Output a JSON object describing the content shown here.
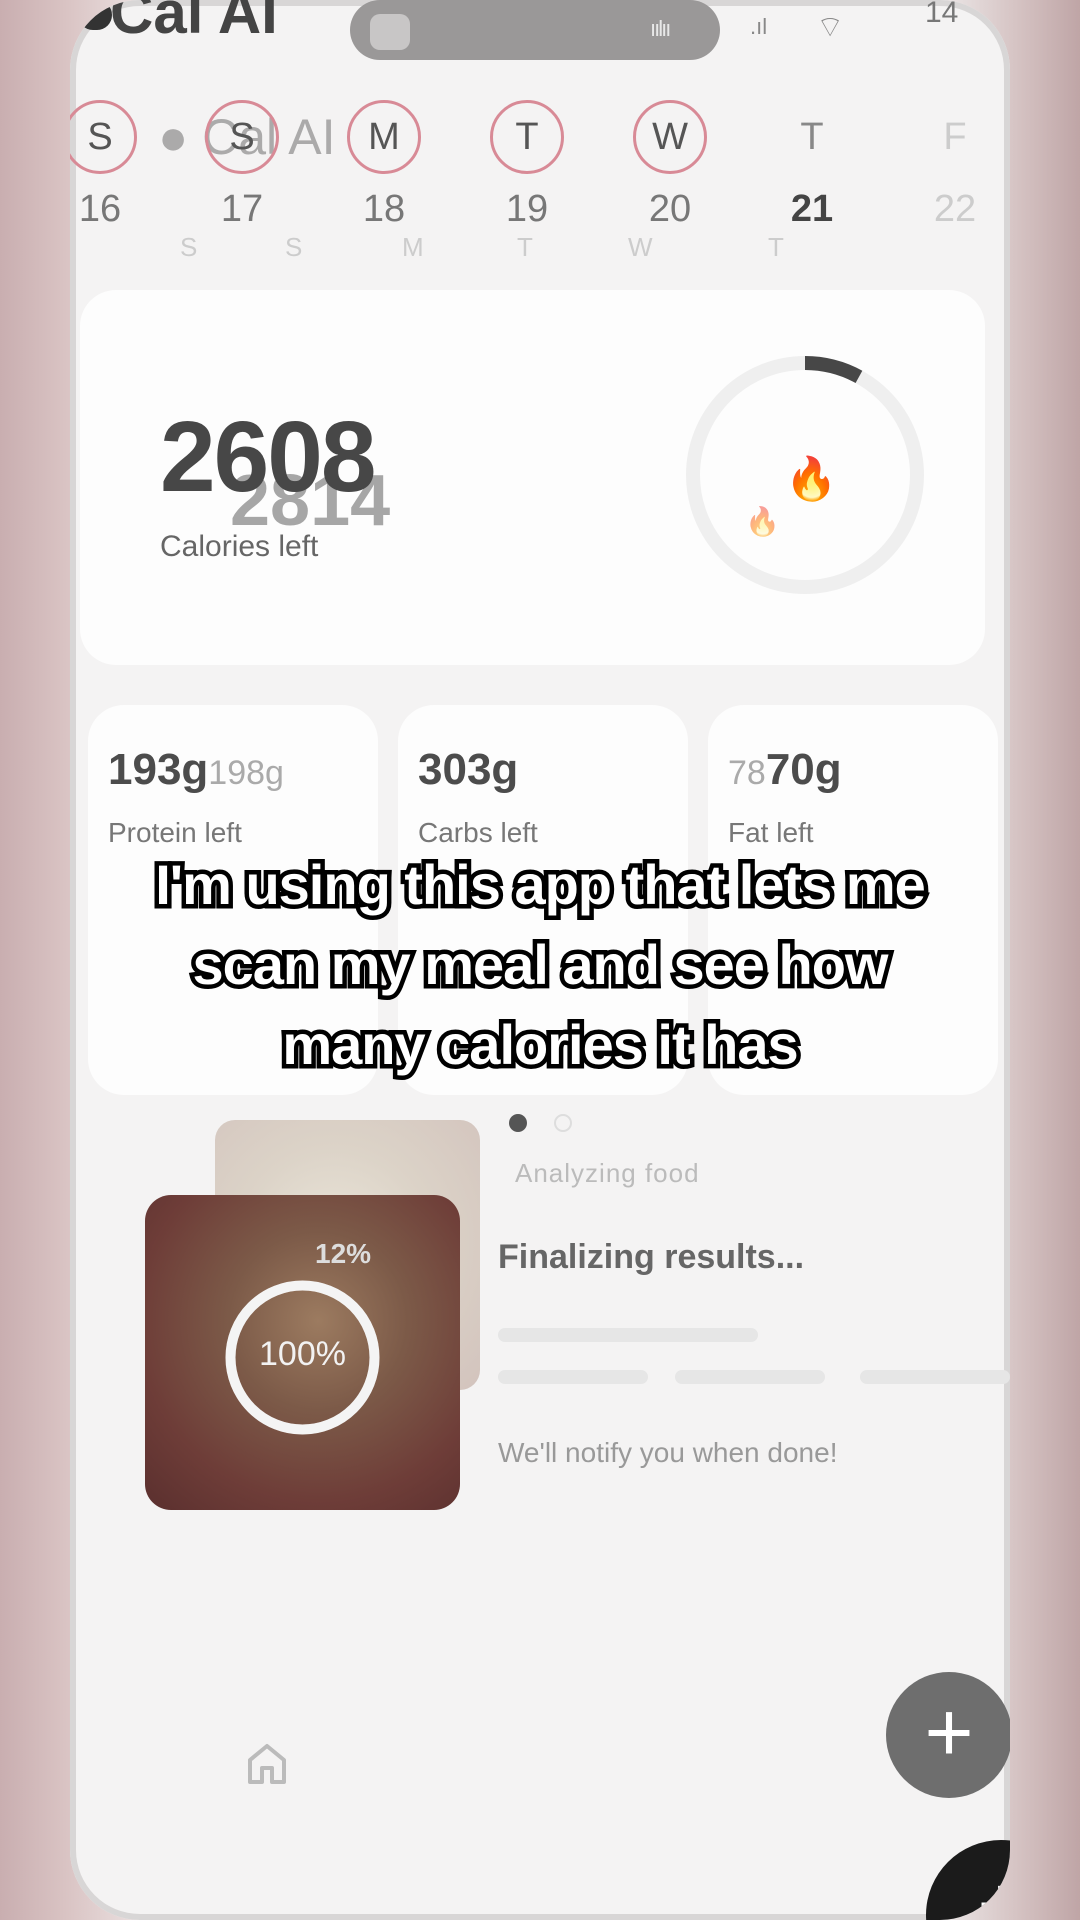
{
  "status_bar": {
    "app_name": "Cal AI",
    "time": "14",
    "signal": ".ıl",
    "wifi_icon": "wifi-icon",
    "audio_wave": "ıılıı"
  },
  "week": {
    "days": [
      {
        "letter": "S",
        "num": "16",
        "state": "logged"
      },
      {
        "letter": "S",
        "num": "17",
        "state": "logged"
      },
      {
        "letter": "M",
        "num": "18",
        "state": "logged"
      },
      {
        "letter": "T",
        "num": "19",
        "state": "logged"
      },
      {
        "letter": "W",
        "num": "20",
        "state": "logged"
      },
      {
        "letter": "T",
        "num": "21",
        "state": "today"
      },
      {
        "letter": "F",
        "num": "22",
        "state": "future"
      }
    ],
    "ghost_letters": [
      "S",
      "S",
      "M",
      "T",
      "W",
      "T"
    ],
    "ghost_nums": [
      "16",
      "17",
      "18",
      "19",
      "20",
      "21"
    ],
    "ghost_logo": "Cal AI"
  },
  "calories": {
    "value": "2608",
    "ghost_value": "2814",
    "label": "Calories left",
    "ring_progress": 0.08
  },
  "macros": [
    {
      "value": "193g",
      "ghost": "198g",
      "label": "Protein left"
    },
    {
      "value": "303g",
      "ghost": "",
      "label": "Carbs left"
    },
    {
      "value": "70g",
      "ghost": "78",
      "label": "Fat left"
    }
  ],
  "caption": {
    "lines": [
      "I'm using this app that lets me",
      "scan my meal and see how",
      "many calories it has"
    ]
  },
  "analysis": {
    "label": "Analyzing food",
    "status": "Finalizing results...",
    "progress_text": "100%",
    "progress_ghost": "12%",
    "progress": 1.0,
    "notify": "We'll notify you when done!"
  },
  "bottom": {
    "fab_label": "+",
    "fab2_label": "+"
  },
  "colors": {
    "ring_accent": "#d88a96",
    "fab": "#6e6e6e"
  }
}
